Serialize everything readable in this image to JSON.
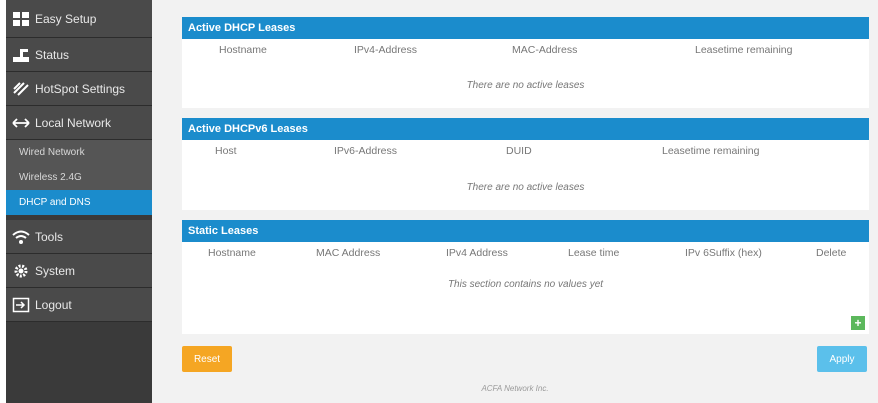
{
  "sidebar": {
    "easy_setup": "Easy Setup",
    "status": "Status",
    "hotspot": "HotSpot Settings",
    "local_network": "Local Network",
    "sub": [
      "Wired Network",
      "Wireless 2.4G",
      "DHCP and DNS"
    ],
    "tools": "Tools",
    "system": "System",
    "logout": "Logout"
  },
  "dhcp": {
    "title": "Active DHCP Leases",
    "cols": [
      "Hostname",
      "IPv4-Address",
      "MAC-Address",
      "Leasetime remaining"
    ],
    "empty": "There are no active leases"
  },
  "dhcpv6": {
    "title": "Active DHCPv6 Leases",
    "cols": [
      "Host",
      "IPv6-Address",
      "DUID",
      "Leasetime remaining"
    ],
    "empty": "There are no active leases"
  },
  "static": {
    "title": "Static Leases",
    "cols": [
      "Hostname",
      "MAC Address",
      "IPv4 Address",
      "Lease time",
      "IPv 6Suffix (hex)",
      "Delete"
    ],
    "empty": "This section contains no values yet",
    "add_glyph": "+"
  },
  "buttons": {
    "reset": "Reset",
    "apply": "Apply"
  },
  "footer": "ACFA Network Inc.",
  "colors": {
    "accent": "#1b8ccc",
    "reset": "#f5a623",
    "apply": "#5bc0eb",
    "add": "#5cb85c"
  }
}
